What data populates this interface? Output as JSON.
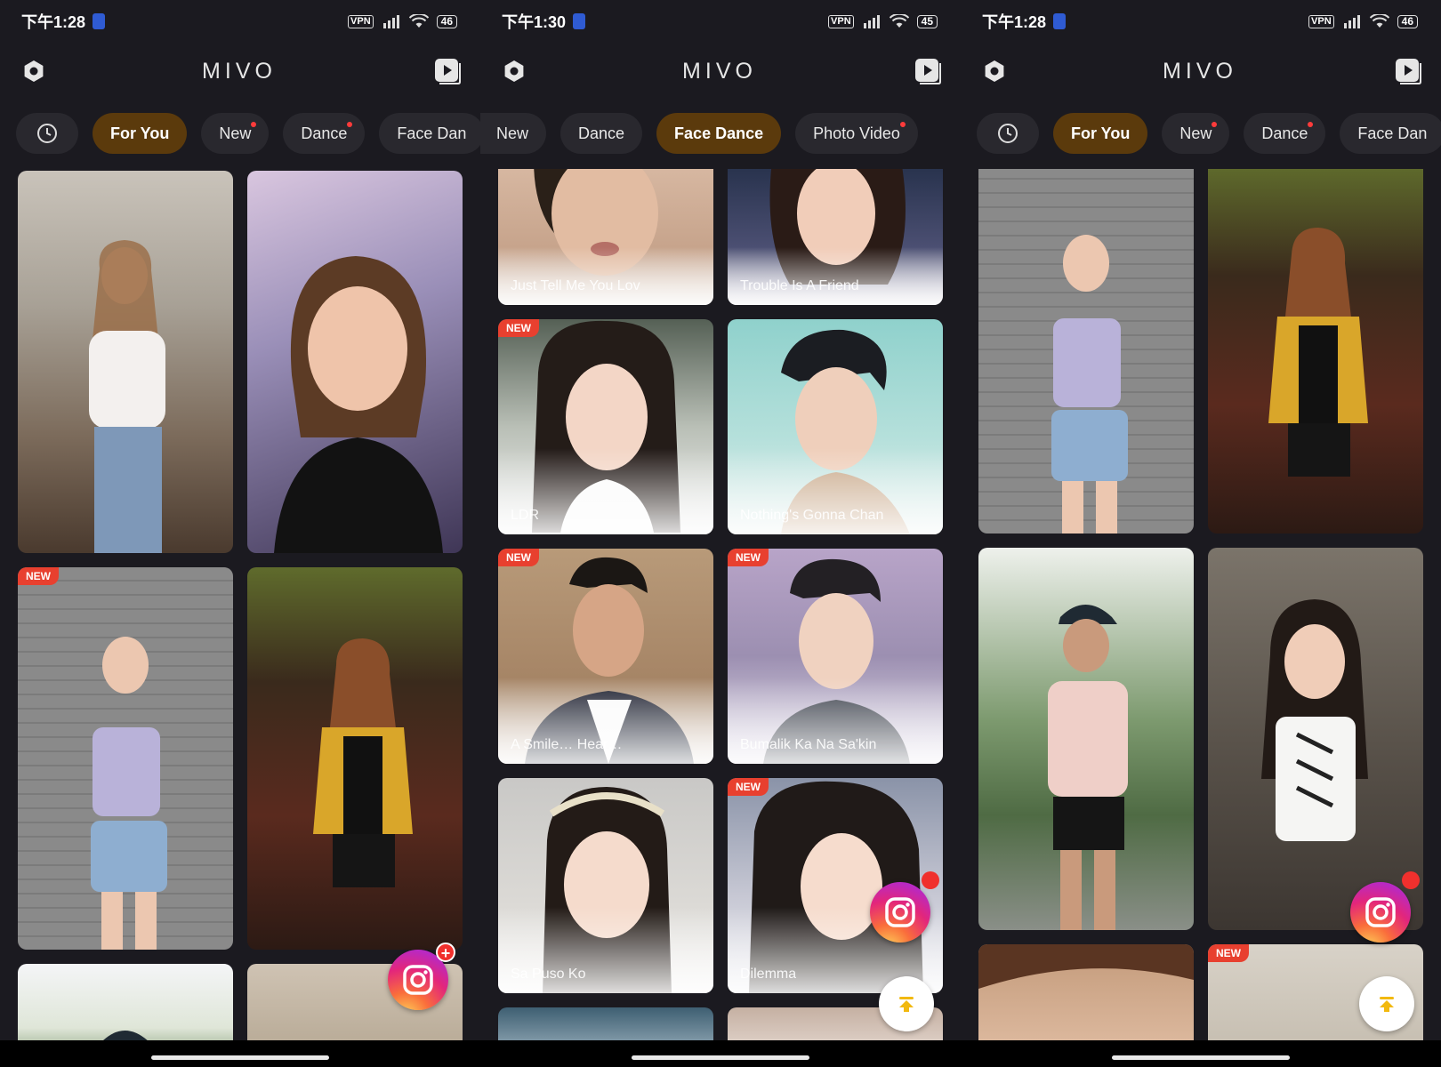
{
  "colors": {
    "accent_tab": "#5b3a0c",
    "badge": "#e8402f",
    "background": "#1b1a20"
  },
  "panels": [
    {
      "status": {
        "time": "下午1:28",
        "vpn": "VPN",
        "battery": "46"
      },
      "app": {
        "title": "MIVO"
      },
      "tabs": [
        {
          "icon": "clock-icon"
        },
        {
          "label": "For You",
          "active": true
        },
        {
          "label": "New",
          "dot": true
        },
        {
          "label": "Dance",
          "dot": true
        },
        {
          "label": "Face Dan"
        }
      ],
      "cards": [
        {
          "caption": "",
          "badge": ""
        },
        {
          "caption": "",
          "badge": ""
        },
        {
          "caption": "",
          "badge": "NEW"
        },
        {
          "caption": "",
          "badge": ""
        },
        {
          "caption": "",
          "badge": ""
        },
        {
          "caption": "",
          "badge": ""
        }
      ]
    },
    {
      "status": {
        "time": "下午1:30",
        "vpn": "VPN",
        "battery": "45"
      },
      "app": {
        "title": "MIVO"
      },
      "tabs": [
        {
          "label": "New"
        },
        {
          "label": "Dance"
        },
        {
          "label": "Face Dance",
          "active": true
        },
        {
          "label": "Photo Video",
          "dot": true
        }
      ],
      "cards": [
        {
          "caption": "Just Tell Me You Lov",
          "badge": ""
        },
        {
          "caption": "Trouble Is A Friend",
          "badge": ""
        },
        {
          "caption": "LDR",
          "badge": "NEW"
        },
        {
          "caption": "Nothing's Gonna Chan",
          "badge": ""
        },
        {
          "caption": "A Smile… Hear…",
          "badge": "NEW"
        },
        {
          "caption": "Bumalik Ka Na Sa'kin",
          "badge": "NEW"
        },
        {
          "caption": "Sa Puso Ko",
          "badge": ""
        },
        {
          "caption": "Dilemma",
          "badge": "NEW"
        },
        {
          "caption": "",
          "badge": ""
        },
        {
          "caption": "",
          "badge": ""
        }
      ]
    },
    {
      "status": {
        "time": "下午1:28",
        "vpn": "VPN",
        "battery": "46"
      },
      "app": {
        "title": "MIVO"
      },
      "tabs": [
        {
          "icon": "clock-icon"
        },
        {
          "label": "For You",
          "active": true
        },
        {
          "label": "New",
          "dot": true
        },
        {
          "label": "Dance",
          "dot": true
        },
        {
          "label": "Face Dan"
        }
      ],
      "cards": [
        {
          "caption": "",
          "badge": ""
        },
        {
          "caption": "",
          "badge": ""
        },
        {
          "caption": "",
          "badge": ""
        },
        {
          "caption": "",
          "badge": ""
        },
        {
          "caption": "",
          "badge": ""
        },
        {
          "caption": "",
          "badge": "NEW"
        }
      ]
    }
  ]
}
